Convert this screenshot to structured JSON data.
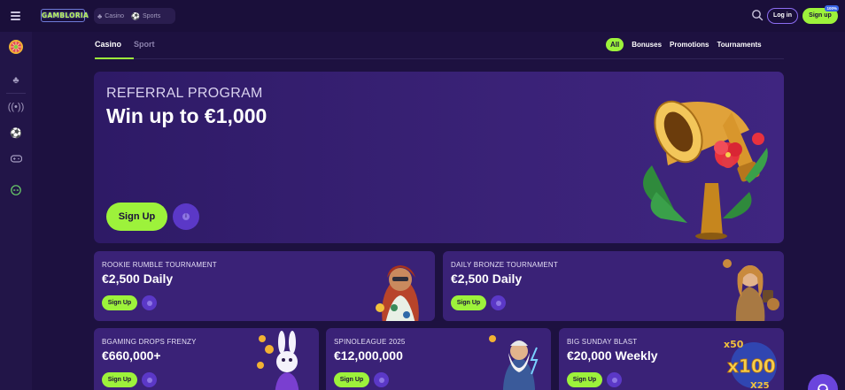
{
  "header": {
    "logo_text": "GAMBLORIA",
    "mode_switch": [
      {
        "label": "Casino",
        "icon": "cherries-icon"
      },
      {
        "label": "Sports",
        "icon": "soccer-ball-icon"
      }
    ],
    "login_label": "Log in",
    "signup_label": "Sign up",
    "signup_bonus": "100%"
  },
  "sidebar": {
    "items": [
      {
        "icon": "wheel-of-fortune-icon"
      },
      {
        "icon": "cherries-icon"
      },
      {
        "icon": "live-broadcast-icon"
      },
      {
        "icon": "soccer-ball-icon"
      },
      {
        "icon": "gamepad-icon"
      },
      {
        "icon": "alien-icon"
      }
    ]
  },
  "tabs": {
    "casino": "Casino",
    "sport": "Sport",
    "active": "Casino"
  },
  "filters": {
    "all": "All",
    "bonuses": "Bonuses",
    "promotions": "Promotions",
    "tournaments": "Tournaments",
    "active": "All"
  },
  "hero": {
    "kicker": "REFERRAL PROGRAM",
    "title": "Win up to €1,000",
    "signup_label": "Sign Up",
    "info_icon": "info-icon"
  },
  "cards": [
    {
      "title": "ROOKIE RUMBLE TOURNAMENT",
      "value": "€2,500 Daily",
      "signup_label": "Sign Up"
    },
    {
      "title": "DAILY BRONZE TOURNAMENT",
      "value": "€2,500 Daily",
      "signup_label": "Sign Up"
    },
    {
      "title": "BGAMING DROPS FRENZY",
      "value": "€660,000+",
      "signup_label": "Sign Up"
    },
    {
      "title": "SPINOLEAGUE 2025",
      "value": "€12,000,000",
      "signup_label": "Sign Up"
    },
    {
      "title": "BIG SUNDAY BLAST",
      "value": "€20,000 Weekly",
      "signup_label": "Sign Up"
    }
  ],
  "colors": {
    "background": "#1d1140",
    "card": "#3a2277",
    "accent_green": "#9df23b",
    "accent_purple": "#5b38c7"
  }
}
